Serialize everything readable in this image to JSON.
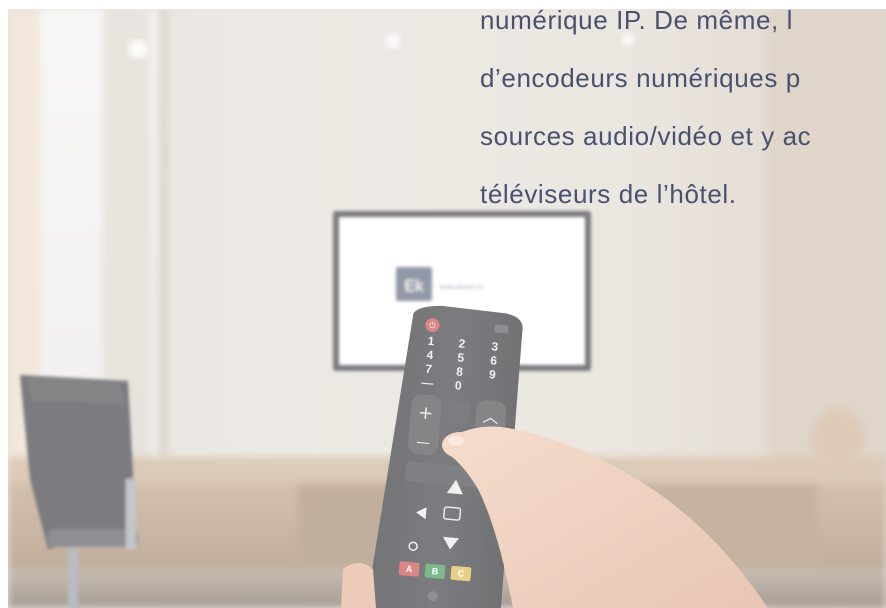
{
  "text_lines": [
    "numérique IP. De même, l",
    "d’encodeurs numériques p",
    "sources audio/vidéo et y ac",
    "téléviseurs de l’hôtel."
  ],
  "tv_screen": {
    "logo_text": "Ek",
    "brand_text": "EKSELANS BY ITS"
  },
  "remote": {
    "power_glyph": "⏻",
    "keypad": [
      "1",
      "2",
      "3",
      "4",
      "5",
      "6",
      "7",
      "8",
      "9",
      "—",
      "0",
      ""
    ],
    "vol_plus": "+",
    "vol_minus": "—",
    "ch_up": "︿",
    "color_keys": [
      "A",
      "B",
      "C"
    ],
    "color_values": [
      "#c53a3a",
      "#2f8f4a",
      "#d8b23a"
    ]
  }
}
